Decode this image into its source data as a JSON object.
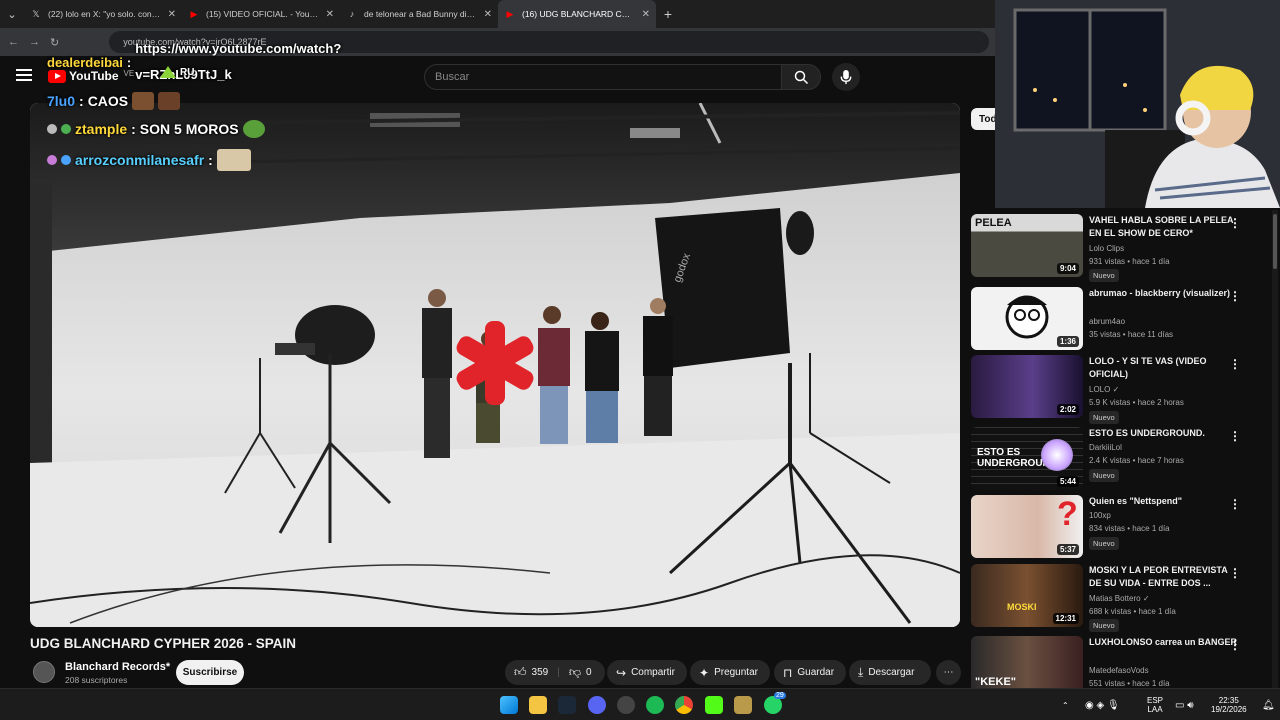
{
  "browser": {
    "tabs": [
      {
        "title": "(22) lolo en X: \"yo solo. contra el",
        "icon": "x-logo-icon"
      },
      {
        "title": "(15) VIDEO OFICIAL. - YouTube",
        "icon": "youtube-icon"
      },
      {
        "title": "de telonear a Bad Bunny directo",
        "icon": "tiktok-icon"
      },
      {
        "title": "(16) UDG BLANCHARD CYPHER",
        "icon": "youtube-icon"
      }
    ],
    "url": "youtube.com/watch?v=jrO6L2877rE"
  },
  "youtube": {
    "logo_text": "YouTube",
    "region": "VE",
    "search_placeholder": "Buscar"
  },
  "chat": [
    {
      "user": "dealerdeibai",
      "message": "https://www.youtube.com/watch?v=RZhL09TtJ_k",
      "extra": "RU"
    },
    {
      "user": "7lu0",
      "message": "CAOS"
    },
    {
      "user": "ztample",
      "message": "SON 5 MOROS"
    },
    {
      "user": "arrozconmilanesafr",
      "message": ""
    }
  ],
  "video": {
    "title": "UDG BLANCHARD CYPHER 2026 - SPAIN",
    "channel": "Blanchard Records*",
    "subscribers": "208 suscriptores",
    "subscribe_label": "Suscribirse",
    "likes": "359",
    "dislikes": "0",
    "share_label": "Compartir",
    "ask_label": "Preguntar",
    "save_label": "Guardar",
    "download_label": "Descargar",
    "watermark": "godox"
  },
  "sidebar": {
    "chip": "Todos",
    "items": [
      {
        "title": "VAHEL HABLA SOBRE LA PELEA EN EL SHOW DE CERO*",
        "channel": "Lolo Clips",
        "stats": "931 vistas • hace 1 día",
        "badge": "Nuevo",
        "duration": "9:04",
        "thumb_text": "PELEA"
      },
      {
        "title": "abrumao - blackberry (visualizer)",
        "channel": "abrum4ao",
        "stats": "35 vistas • hace 11 días",
        "badge": "",
        "duration": "1:36",
        "thumb_text": ""
      },
      {
        "title": "LOLO - Y SI TE VAS (VIDEO OFICIAL)",
        "channel": "LOLO",
        "stats": "5.9 K vistas • hace 2 horas",
        "badge": "Nuevo",
        "duration": "2:02",
        "thumb_text": ""
      },
      {
        "title": "ESTO ES UNDERGROUND.",
        "channel": "DarkiiiLol",
        "stats": "2.4 K vistas • hace 7 horas",
        "badge": "Nuevo",
        "duration": "5:44",
        "thumb_text": "ESTO ES UNDERGROUND"
      },
      {
        "title": "Quien es \"Nettspend\"",
        "channel": "100xp",
        "stats": "834 vistas • hace 1 día",
        "badge": "Nuevo",
        "duration": "5:37",
        "thumb_text": "?"
      },
      {
        "title": "MOSKI Y LA PEOR ENTREVISTA DE SU VIDA - ENTRE DOS ...",
        "channel": "Matias Bottero",
        "stats": "688 k vistas • hace 1 día",
        "badge": "Nuevo",
        "duration": "12:31",
        "thumb_text": "MOSKI"
      },
      {
        "title": "LUXHOLONSO carrea un BANGER",
        "channel": "MatedefasoVods",
        "stats": "551 vistas • hace 1 día",
        "badge": "",
        "duration": "",
        "thumb_text": "\"KEKE\""
      }
    ]
  },
  "taskbar": {
    "lang_top": "ESP",
    "lang_bottom": "LAA",
    "time": "22:35",
    "date": "19/2/2026",
    "notif_count": "29"
  },
  "colors": {
    "yt_red": "#ff0000",
    "bg": "#0f0f0f",
    "chat_gold": "#ffd83b",
    "chat_blue": "#4aa3ff"
  }
}
